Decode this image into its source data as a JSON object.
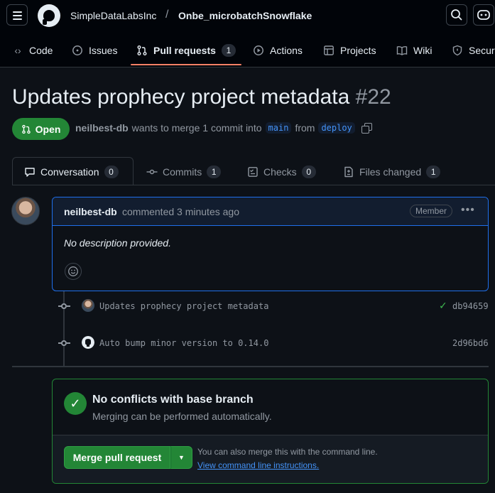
{
  "header": {
    "owner": "SimpleDataLabsInc",
    "separator": "/",
    "repo": "Onbe_microbatchSnowflake"
  },
  "nav": {
    "tabs": [
      {
        "label": "Code",
        "icon": "code-icon"
      },
      {
        "label": "Issues",
        "icon": "issue-icon"
      },
      {
        "label": "Pull requests",
        "icon": "pull-request-icon",
        "count": "1",
        "active": true
      },
      {
        "label": "Actions",
        "icon": "play-icon"
      },
      {
        "label": "Projects",
        "icon": "table-icon"
      },
      {
        "label": "Wiki",
        "icon": "book-icon"
      },
      {
        "label": "Secur",
        "icon": "shield-icon"
      }
    ]
  },
  "pr": {
    "title": "Updates prophecy project metadata",
    "number": "#22",
    "state": "Open",
    "author": "neilbest-db",
    "merge_text_1": "wants to merge 1 commit into",
    "base_branch": "main",
    "merge_text_2": "from",
    "head_branch": "deploy"
  },
  "pr_tabs": [
    {
      "label": "Conversation",
      "count": "0"
    },
    {
      "label": "Commits",
      "count": "1"
    },
    {
      "label": "Checks",
      "count": "0"
    },
    {
      "label": "Files changed",
      "count": "1"
    }
  ],
  "comment": {
    "author": "neilbest-db",
    "action": "commented 3 minutes ago",
    "role": "Member",
    "menu": "•••",
    "body": "No description provided."
  },
  "timeline": [
    {
      "message": "Updates prophecy project metadata",
      "sha": "db94659",
      "verified": true
    },
    {
      "message": "Auto bump minor version to 0.14.0",
      "sha": "2d96bd6",
      "verified": false
    }
  ],
  "merge": {
    "title": "No conflicts with base branch",
    "subtitle": "Merging can be performed automatically.",
    "button": "Merge pull request",
    "hint": "You can also merge this with the command line.",
    "link": "View command line instructions."
  },
  "colors": {
    "background": "#0d1117",
    "accent_green": "#238636",
    "link_blue": "#4493f8",
    "tab_underline": "#f78166"
  }
}
